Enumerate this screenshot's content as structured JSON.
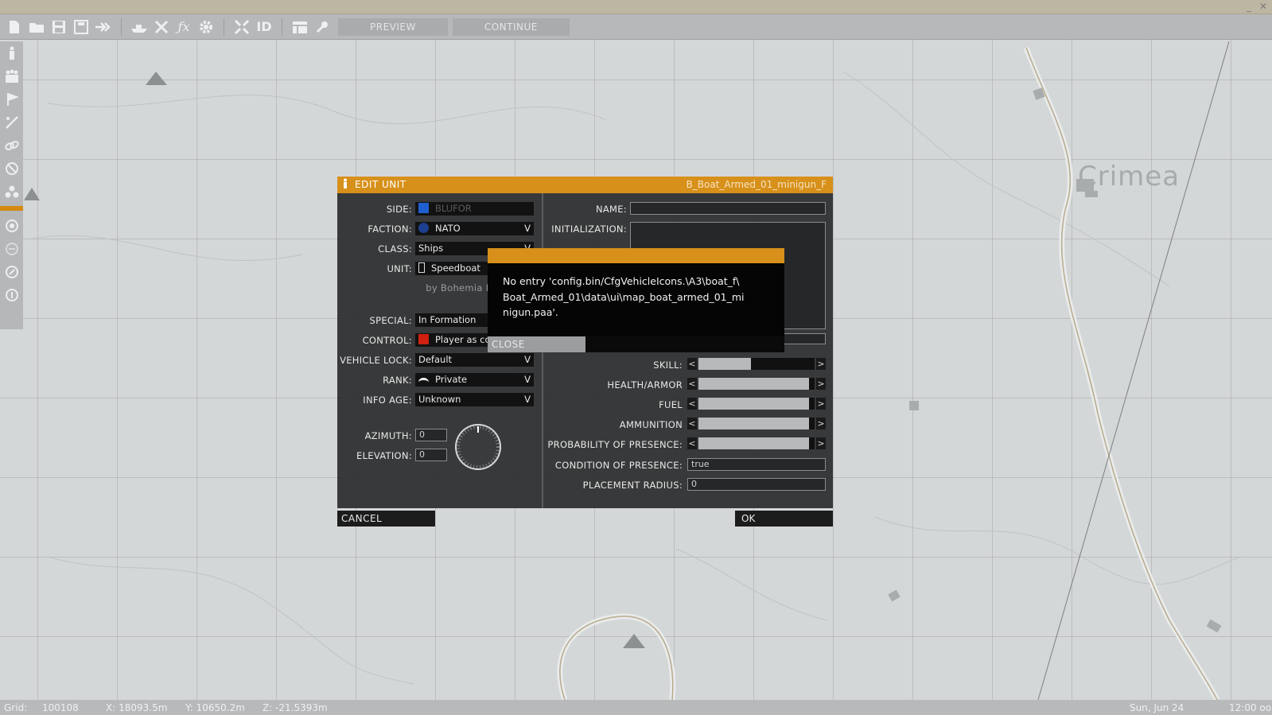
{
  "toolbar": {
    "icons": [
      "new-file-icon",
      "open-folder-icon",
      "save-icon",
      "save-as-icon",
      "export-icon",
      "ship-icon",
      "tools-icon",
      "function-icon",
      "gear-icon",
      "expand-icon",
      "id-icon",
      "table-icon",
      "wrench-icon"
    ],
    "preview_label": "PREVIEW",
    "continue_label": "CONTINUE"
  },
  "window_controls": {
    "minimize": "_",
    "close": "✕"
  },
  "sidebar": {
    "icons": [
      "soldier-icon",
      "group-icon",
      "waypoint-flag-icon",
      "sync-icon",
      "link-icon",
      "trigger-icon",
      "marker-icon",
      "module-1-icon",
      "module-2-icon",
      "module-3-icon",
      "module-4-icon"
    ]
  },
  "map": {
    "label": "Crimea"
  },
  "status": {
    "grid_label": "Grid:",
    "grid_value": "100108",
    "x": "X: 18093.5m",
    "y": "Y: 10650.2m",
    "z": "Z: -21.5393m",
    "date": "Sun, Jun 24",
    "time": "12:00 oo"
  },
  "dialog": {
    "title": "EDIT UNIT",
    "classname": "B_Boat_Armed_01_minigun_F",
    "left": {
      "side_label": "SIDE:",
      "side_value": "BLUFOR",
      "side_color": "#1f5fd1",
      "faction_label": "FACTION:",
      "faction_value": "NATO",
      "class_label": "CLASS:",
      "class_value": "Ships",
      "unit_label": "UNIT:",
      "unit_value": "Speedboat",
      "author": "by Bohemia In",
      "special_label": "SPECIAL:",
      "special_value": "In Formation",
      "control_label": "CONTROL:",
      "control_value": "Player as comma",
      "control_color": "#d12010",
      "lock_label": "VEHICLE LOCK:",
      "lock_value": "Default",
      "rank_label": "RANK:",
      "rank_value": "Private",
      "info_label": "INFO AGE:",
      "info_value": "Unknown",
      "azimuth_label": "AZIMUTH:",
      "azimuth_value": "0",
      "elevation_label": "ELEVATION:",
      "elevation_value": "0",
      "dropdown_glyph": "V"
    },
    "right": {
      "name_label": "NAME:",
      "init_label": "INITIALIZATION:",
      "skill_label": "SKILL:",
      "skill_level": 0.45,
      "health_label": "HEALTH/ARMOR",
      "health_level": 0.95,
      "fuel_label": "FUEL",
      "fuel_level": 0.95,
      "ammo_label": "AMMUNITION",
      "ammo_level": 0.95,
      "prob_label": "PROBABILITY OF PRESENCE:",
      "prob_level": 0.95,
      "cond_label": "CONDITION OF PRESENCE:",
      "cond_value": "true",
      "radius_label": "PLACEMENT RADIUS:",
      "radius_value": "0",
      "arrow_left": "<",
      "arrow_right": ">"
    },
    "cancel_label": "CANCEL",
    "ok_label": "OK"
  },
  "error": {
    "message": "No entry 'config.bin/CfgVehicleIcons.\\A3\\boat_f\\ Boat_Armed_01\\data\\ui\\map_boat_armed_01_mi nigun.paa'.",
    "close_label": "CLOSE"
  },
  "colors": {
    "accent": "#d7901a",
    "panel": "#2a2b2c"
  }
}
